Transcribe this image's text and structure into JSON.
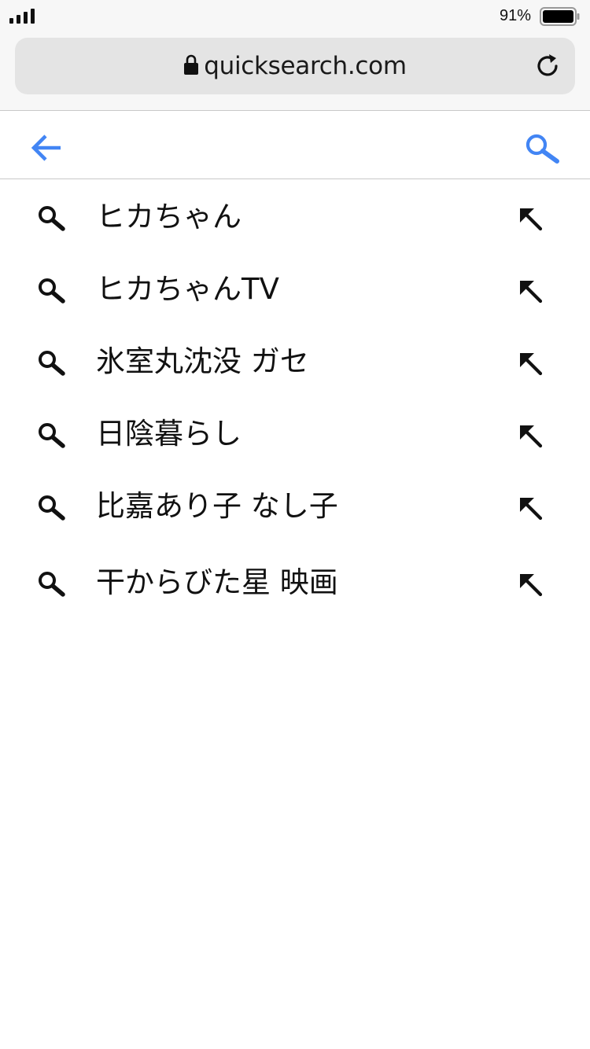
{
  "status_bar": {
    "battery_percent_label": "91%",
    "battery_level": 0.91
  },
  "browser": {
    "url": "quicksearch.com"
  },
  "search": {
    "query": "",
    "placeholder": ""
  },
  "suggestions": [
    {
      "label": "ヒカちゃん"
    },
    {
      "label": "ヒカちゃんTV"
    },
    {
      "label": "氷室丸沈没 ガセ"
    },
    {
      "label": "日陰暮らし"
    },
    {
      "label": "比嘉あり子 なし子"
    },
    {
      "label": "干からびた星 映画"
    }
  ],
  "colors": {
    "accent": "#4285f4",
    "chrome_bg": "#f7f7f7",
    "url_bar_bg": "#e4e4e4",
    "text": "#111111"
  },
  "icons": {
    "signal": "signal-bars-icon",
    "battery": "battery-icon",
    "lock": "lock-icon",
    "reload": "reload-icon",
    "back": "back-arrow-icon",
    "search": "search-icon",
    "suggestion": "magnifier-icon",
    "fill_query": "arrow-up-left-icon"
  }
}
